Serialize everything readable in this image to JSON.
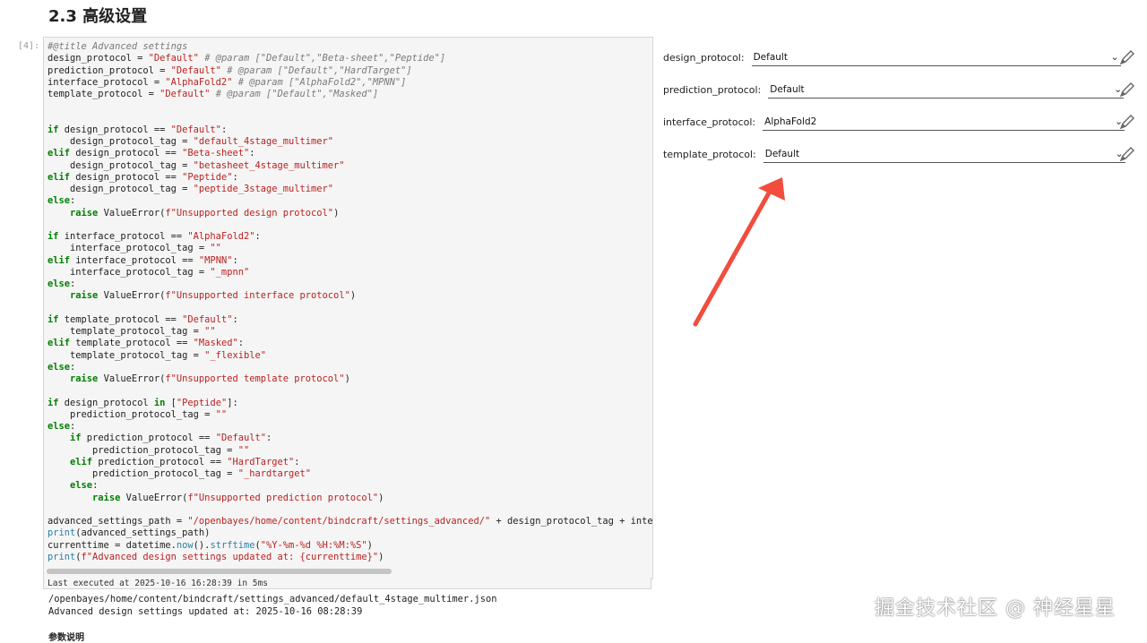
{
  "heading": "2.3 高级设置",
  "cell": {
    "prompt": "[4]:",
    "status": "Last executed at 2025-10-16 16:28:39 in 5ms"
  },
  "output": {
    "lines": [
      "/openbayes/home/content/bindcraft/settings_advanced/default_4stage_multimer.json",
      "Advanced design settings updated at: 2025-10-16 08:28:39"
    ],
    "cut_text": "参数说明"
  },
  "form": {
    "fields": [
      {
        "label": "design_protocol:",
        "value": "Default"
      },
      {
        "label": "prediction_protocol:",
        "value": "Default"
      },
      {
        "label": "interface_protocol:",
        "value": "AlphaFold2"
      },
      {
        "label": "template_protocol:",
        "value": "Default"
      }
    ]
  },
  "watermark": "掘金技术社区 @ 神经星星",
  "icons": {
    "dropdown": "chevron-down-icon",
    "edit": "pencil-icon"
  },
  "colors": {
    "keyword": "#008000",
    "string": "#ba2121",
    "comment": "#7a7a7a",
    "arrow": "#f24c3d"
  }
}
